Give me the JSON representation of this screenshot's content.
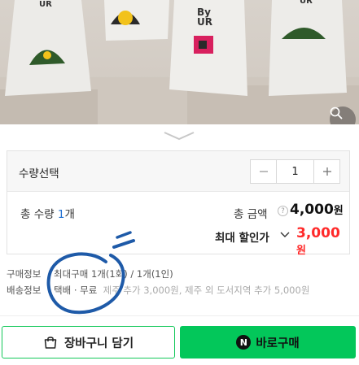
{
  "photo": {
    "pack_text_1": "UR",
    "pack_text_2": "By",
    "pack_text_3": "UR",
    "pack_text_4": "UR"
  },
  "quantity": {
    "label": "수량선택",
    "value": "1",
    "minus_icon": "minus-icon",
    "plus_icon": "plus-icon"
  },
  "totals": {
    "qty_prefix": "총 수량 ",
    "qty_num": "1",
    "qty_suffix": "개",
    "amount_label": "총 금액",
    "help_mark": "?",
    "amount_value": "4,000",
    "amount_unit": "원",
    "discount_label": "최대 할인가",
    "discount_value": "3,000",
    "discount_unit": "원"
  },
  "info": {
    "purchase_label": "구매정보",
    "purchase_text": "최대구매 1개(1회) / 1개(1인)",
    "shipping_label": "배송정보",
    "shipping_text": "택배 · 무료",
    "shipping_extra": "제주 추가 3,000원, 제주 외 도서지역 추가 5,000원"
  },
  "buttons": {
    "cart_label": "장바구니 담기",
    "buy_label": "바로구매",
    "npay_mark": "N"
  },
  "colors": {
    "accent_green": "#03c75a",
    "discount_red": "#ff2a2a",
    "qty_blue": "#1f6fd1"
  }
}
